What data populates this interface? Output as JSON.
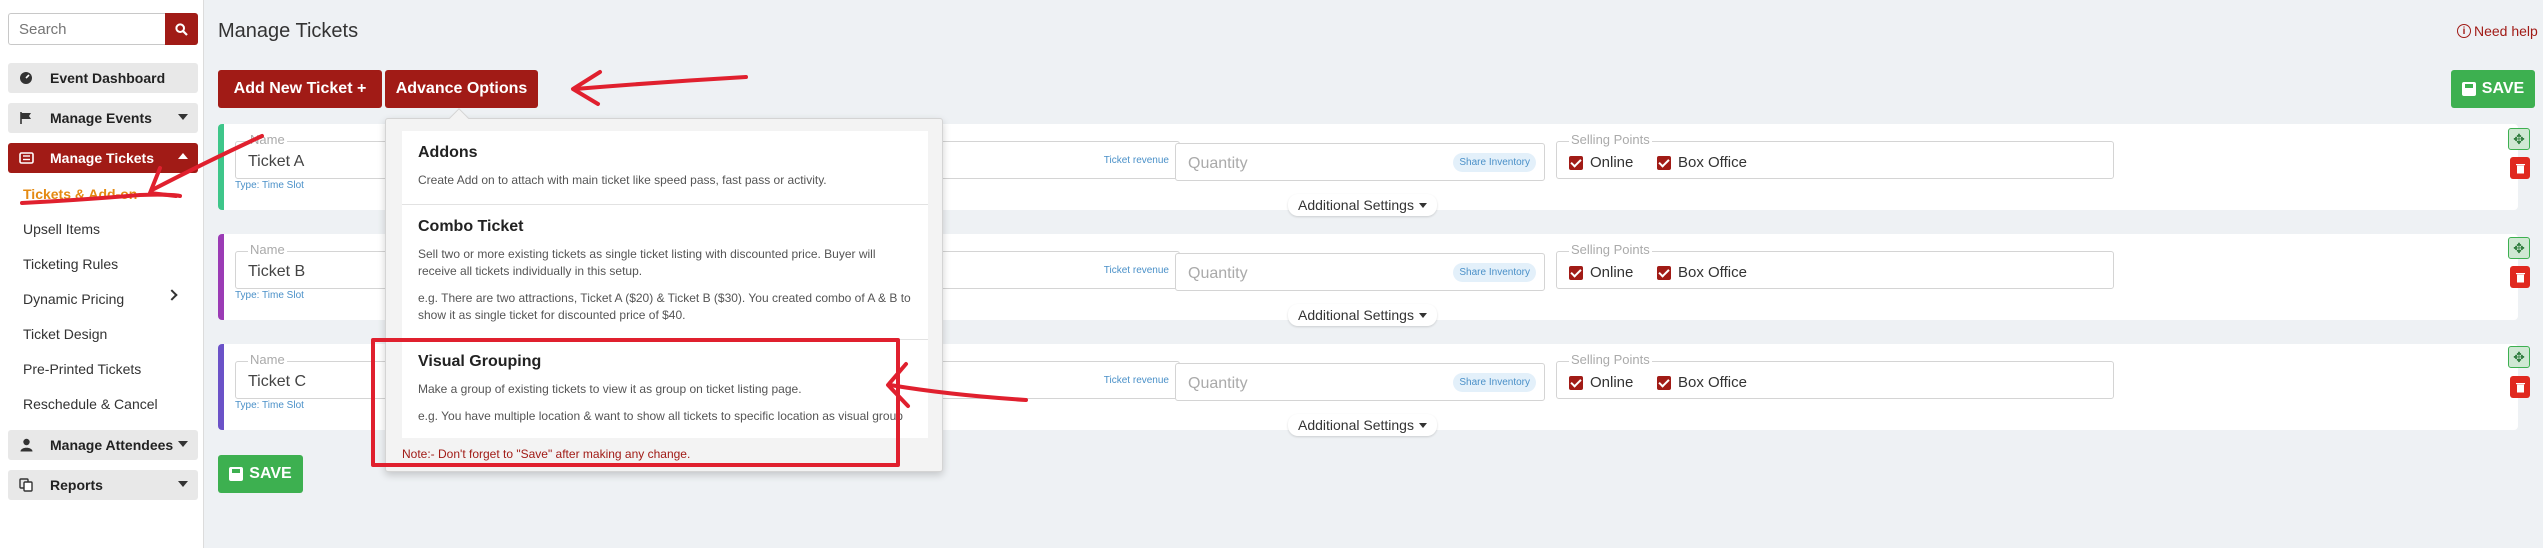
{
  "sidebar": {
    "search_placeholder": "Search",
    "items": [
      {
        "label": "Event Dashboard",
        "icon": "gauge-icon"
      },
      {
        "label": "Manage Events",
        "icon": "flag-icon"
      },
      {
        "label": "Manage Tickets",
        "icon": "ticket-icon"
      },
      {
        "label": "Manage Attendees",
        "icon": "user-icon"
      },
      {
        "label": "Reports",
        "icon": "copy-icon"
      }
    ],
    "sub_items": [
      "Tickets & Add-on",
      "Upsell Items",
      "Ticketing Rules",
      "Dynamic Pricing",
      "Ticket Design",
      "Pre-Printed Tickets",
      "Reschedule & Cancel"
    ]
  },
  "header": {
    "title": "Manage Tickets",
    "need_help": "Need help"
  },
  "toolbar": {
    "add_new_ticket": "Add New Ticket +",
    "advance_options": "Advance Options",
    "save_top": "SAVE",
    "save_bottom": "SAVE"
  },
  "tickets": [
    {
      "name_label": "Name",
      "name": "Ticket A",
      "type": "Type: Time Slot",
      "revenue_tag": "Ticket revenue",
      "quantity_placeholder": "Quantity",
      "share_inventory": "Share Inventory",
      "selling_points_label": "Selling Points",
      "online": "Online",
      "box_office": "Box Office",
      "additional_settings": "Additional Settings",
      "stripe_color": "#3ec68a"
    },
    {
      "name_label": "Name",
      "name": "Ticket B",
      "type": "Type: Time Slot",
      "revenue_tag": "Ticket revenue",
      "quantity_placeholder": "Quantity",
      "share_inventory": "Share Inventory",
      "selling_points_label": "Selling Points",
      "online": "Online",
      "box_office": "Box Office",
      "additional_settings": "Additional Settings",
      "stripe_color": "#9b3bb5"
    },
    {
      "name_label": "Name",
      "name": "Ticket C",
      "type": "Type: Time Slot",
      "revenue_tag": "Ticket revenue",
      "quantity_placeholder": "Quantity",
      "share_inventory": "Share Inventory",
      "selling_points_label": "Selling Points",
      "online": "Online",
      "box_office": "Box Office",
      "additional_settings": "Additional Settings",
      "stripe_color": "#6b52c8"
    }
  ],
  "advance_menu": {
    "sections": [
      {
        "title": "Addons",
        "desc": "Create Add on to attach with main ticket like speed pass, fast pass or activity."
      },
      {
        "title": "Combo Ticket",
        "desc": "Sell two or more existing tickets as single ticket listing with discounted price. Buyer will receive all tickets individually in this setup.",
        "example": "e.g. There are two attractions, Ticket A ($20) & Ticket B ($30). You created combo of A & B to show it as single ticket for discounted price of $40."
      },
      {
        "title": "Visual Grouping",
        "desc": "Make a group of existing tickets to view it as group on ticket listing page.",
        "example": "e.g. You have multiple location & want to show all tickets to specific location as visual group"
      }
    ],
    "note": "Note:- Don't forget to \"Save\" after making any change."
  },
  "colors": {
    "brand_red": "#a11b16",
    "save_green": "#3db050",
    "annotation_red": "#e0202e",
    "active_sub": "#e48a12"
  }
}
